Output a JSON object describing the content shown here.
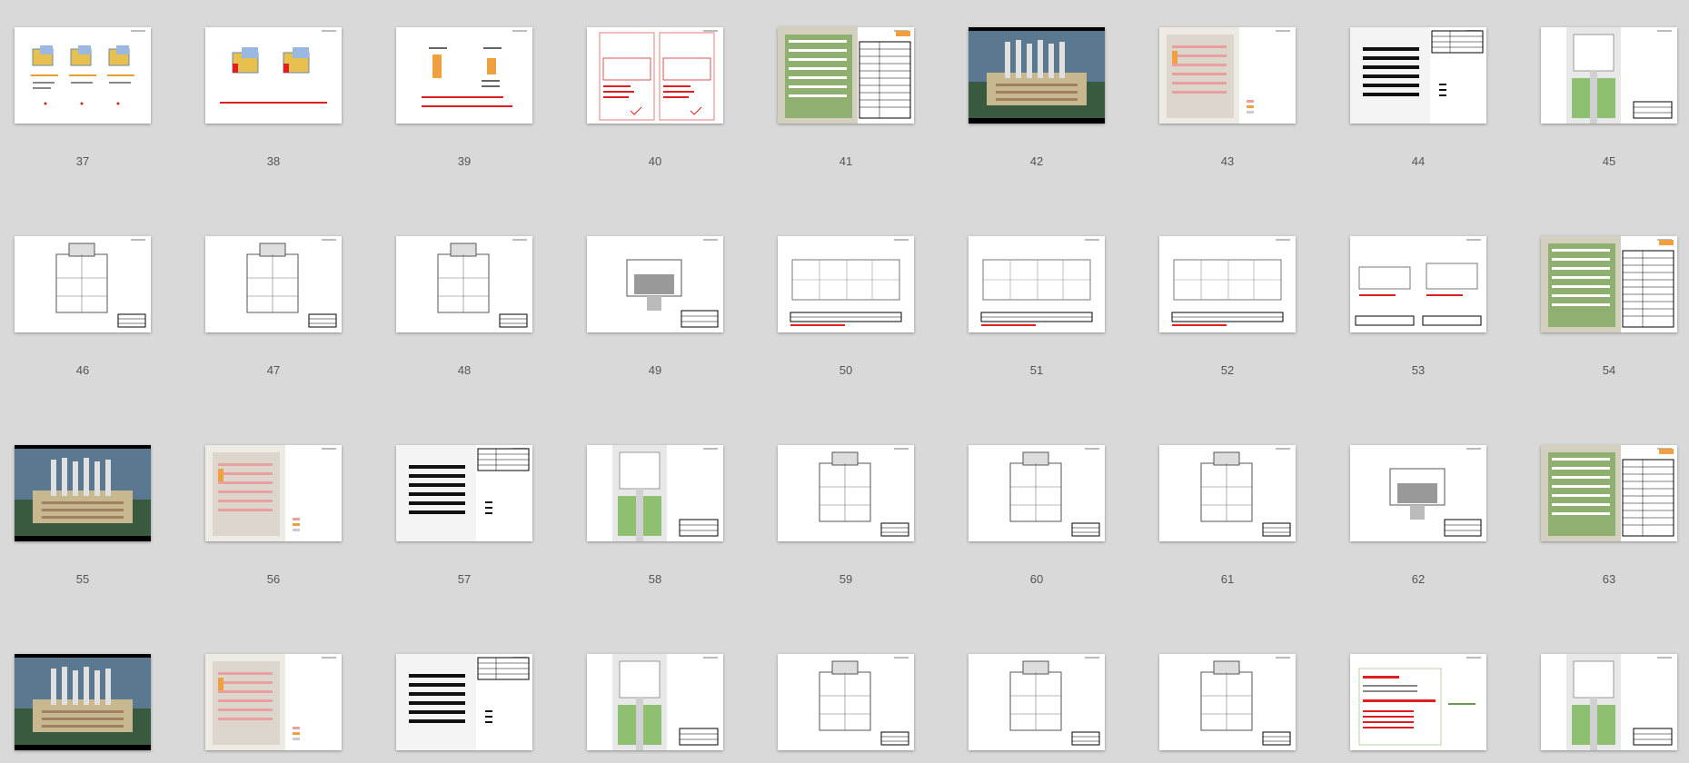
{
  "slides": [
    {
      "number": "37",
      "thumb": "diagram-blocks-icon"
    },
    {
      "number": "38",
      "thumb": "diagram-two-blocks-icon"
    },
    {
      "number": "39",
      "thumb": "diagram-orange-bars-icon"
    },
    {
      "number": "40",
      "thumb": "comparison-table-icon"
    },
    {
      "number": "41",
      "thumb": "site-plan-with-table-icon"
    },
    {
      "number": "42",
      "thumb": "aerial-render-icon"
    },
    {
      "number": "43",
      "thumb": "colored-site-plan-icon"
    },
    {
      "number": "44",
      "thumb": "black-site-plan-icon"
    },
    {
      "number": "45",
      "thumb": "vertical-site-plan-icon"
    },
    {
      "number": "46",
      "thumb": "floor-plan-icon"
    },
    {
      "number": "47",
      "thumb": "floor-plan-icon"
    },
    {
      "number": "48",
      "thumb": "floor-plan-icon"
    },
    {
      "number": "49",
      "thumb": "floor-plan-gray-icon"
    },
    {
      "number": "50",
      "thumb": "wide-floor-plan-icon"
    },
    {
      "number": "51",
      "thumb": "wide-floor-plan-icon"
    },
    {
      "number": "52",
      "thumb": "wide-floor-plan-icon"
    },
    {
      "number": "53",
      "thumb": "double-floor-plan-icon"
    },
    {
      "number": "54",
      "thumb": "site-plan-with-table-icon"
    },
    {
      "number": "55",
      "thumb": "aerial-render-icon"
    },
    {
      "number": "56",
      "thumb": "colored-site-plan-icon"
    },
    {
      "number": "57",
      "thumb": "black-site-plan-icon"
    },
    {
      "number": "58",
      "thumb": "vertical-site-plan-icon"
    },
    {
      "number": "59",
      "thumb": "floor-plan-icon"
    },
    {
      "number": "60",
      "thumb": "floor-plan-icon"
    },
    {
      "number": "61",
      "thumb": "floor-plan-icon"
    },
    {
      "number": "62",
      "thumb": "floor-plan-gray-icon"
    },
    {
      "number": "63",
      "thumb": "site-plan-with-table-icon"
    },
    {
      "number": "",
      "thumb": "aerial-render-icon"
    },
    {
      "number": "",
      "thumb": "colored-site-plan-icon"
    },
    {
      "number": "",
      "thumb": "black-site-plan-icon"
    },
    {
      "number": "",
      "thumb": "vertical-site-plan-icon"
    },
    {
      "number": "",
      "thumb": "floor-plan-icon"
    },
    {
      "number": "",
      "thumb": "floor-plan-icon"
    },
    {
      "number": "",
      "thumb": "floor-plan-icon"
    },
    {
      "number": "",
      "thumb": "text-slide-icon"
    },
    {
      "number": "",
      "thumb": "vertical-site-plan-icon"
    }
  ],
  "colors": {
    "background": "#d9d9d9",
    "slide": "#ffffff",
    "number": "#555555",
    "accent_red": "#e02020",
    "accent_orange": "#f0a040",
    "plan_green": "#6a9a50"
  }
}
